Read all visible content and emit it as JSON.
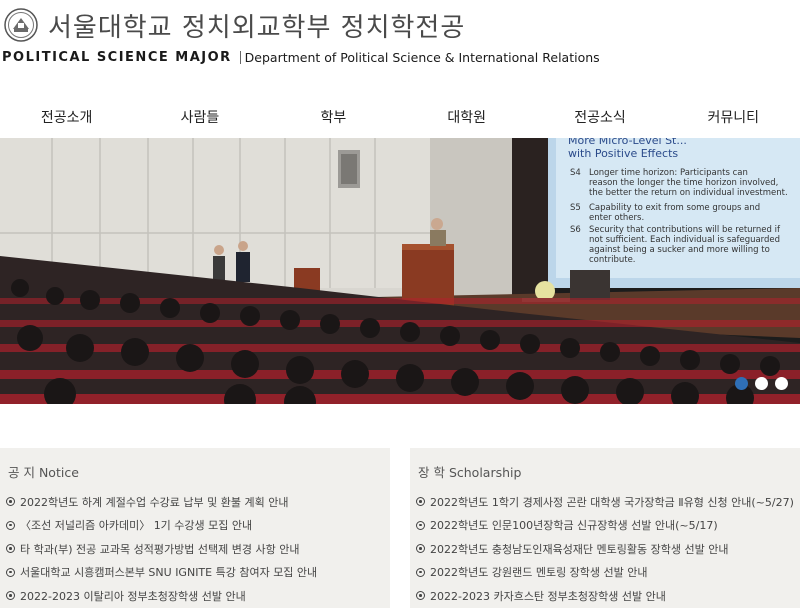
{
  "header": {
    "title": "서울대학교 정치외교학부 정치학전공",
    "major_label": "POLITICAL  SCIENCE  MAJOR",
    "department": "Department of Political Science & International Relations"
  },
  "nav": {
    "items": [
      "전공소개",
      "사람들",
      "학부",
      "대학원",
      "전공소식",
      "커뮤니티"
    ]
  },
  "hero": {
    "slide": {
      "heading_line1": "More Micro-Level St...",
      "heading_line2": "with Positive Effects",
      "points": [
        {
          "num": "S4",
          "line1": "Longer time horizon: Participants can",
          "line2": "reason the longer the time horizon involved,",
          "line3": "the better the return on individual investment."
        },
        {
          "num": "S5",
          "line1": "Capability to exit from some groups and",
          "line2": "enter others.",
          "line3": ""
        },
        {
          "num": "S6",
          "line1": "Security that contributions will be returned if",
          "line2": "not sufficient.  Each individual is safeguarded",
          "line3": "against being a sucker and more willing to"
        }
      ],
      "tail": "contribute."
    },
    "slider_dots": 3,
    "active_dot": 0
  },
  "notice": {
    "title": "공 지 Notice",
    "items": [
      "2022학년도 하계 계절수업 수강료 납부 및 환불 계획 안내",
      "〈조선 저널리즘 아카데미〉 1기 수강생 모집 안내",
      "타 학과(부) 전공 교과목 성적평가방법 선택제 변경 사항 안내",
      "서울대학교 시흥캠퍼스본부 SNU IGNITE 특강 참여자 모집 안내",
      "2022-2023 이탈리아 정부초청장학생 선발 안내"
    ]
  },
  "scholarship": {
    "title": "장 학 Scholarship",
    "items": [
      "2022학년도 1학기 경제사정 곤란 대학생 국가장학금 Ⅱ유형 신청 안내(~5/27)",
      "2022학년도 인문100년장학금 신규장학생 선발 안내(~5/17)",
      "2022학년도 충청남도인재육성재단 멘토링활동 장학생 선발 안내",
      "2022학년도 강원랜드 멘토링 장학생 선발 안내",
      "2022-2023 카자흐스탄 정부초청장학생 선발 안내"
    ]
  },
  "colors": {
    "active_dot": "#2f6fb7",
    "board_bg": "#f1f0ed",
    "seat_red": "#b3202c"
  }
}
